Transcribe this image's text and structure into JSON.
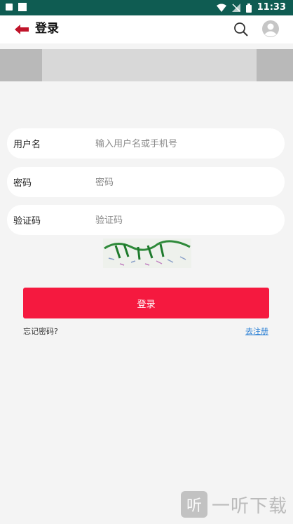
{
  "status_bar": {
    "time": "11:33"
  },
  "header": {
    "title": "登录"
  },
  "form": {
    "username": {
      "label": "用户名",
      "placeholder": "输入用户名或手机号",
      "value": ""
    },
    "password": {
      "label": "密码",
      "placeholder": "密码",
      "value": ""
    },
    "captcha": {
      "label": "验证码",
      "placeholder": "验证码",
      "value": ""
    }
  },
  "login_button": "登录",
  "links": {
    "forgot": "忘记密码?",
    "register": "去注册"
  },
  "watermark": {
    "logo": "听",
    "text": "一听下载"
  },
  "colors": {
    "status_bar": "#0f5c52",
    "accent": "#f5193f",
    "link": "#2a7fd4",
    "back_arrow": "#c0142a"
  },
  "icons": [
    "back-arrow-icon",
    "search-icon",
    "user-avatar-icon"
  ]
}
